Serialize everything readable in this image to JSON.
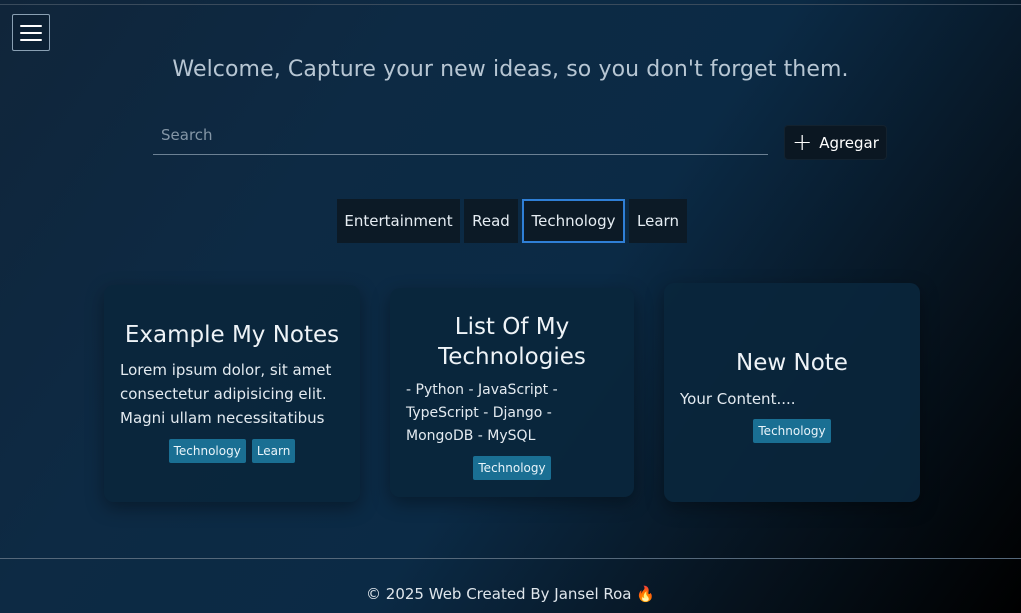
{
  "header": {
    "menu_icon": "hamburger-menu-icon",
    "welcome": "Welcome, Capture your new ideas, so you don't forget them."
  },
  "search": {
    "placeholder": "Search",
    "value": ""
  },
  "add_button": {
    "icon": "plus-icon",
    "icon_glyph": "+",
    "label": "Agregar"
  },
  "filters": [
    {
      "label": "Entertainment",
      "active": false
    },
    {
      "label": "Read",
      "active": false
    },
    {
      "label": "Technology",
      "active": true
    },
    {
      "label": "Learn",
      "active": false
    }
  ],
  "notes": [
    {
      "title": "Example My Notes",
      "content": "Lorem ipsum dolor, sit amet consectetur adipisicing elit. Magni ullam necessitatibus sit dicta eligendi. Doloremque",
      "tags": [
        "Technology",
        "Learn"
      ]
    },
    {
      "title": "List Of My Technologies",
      "content": "- Python - JavaScript - TypeScript - Django - MongoDB - MySQL",
      "tags": [
        "Technology"
      ]
    },
    {
      "title": "New Note",
      "content": "Your Content....",
      "tags": [
        "Technology"
      ]
    }
  ],
  "footer": {
    "text": "© 2025 Web Created By Jansel Roa 🔥"
  },
  "colors": {
    "accent_border": "#2f7fd6",
    "tag_bg": "#1a6f93",
    "card_bg": "#0a263c"
  }
}
